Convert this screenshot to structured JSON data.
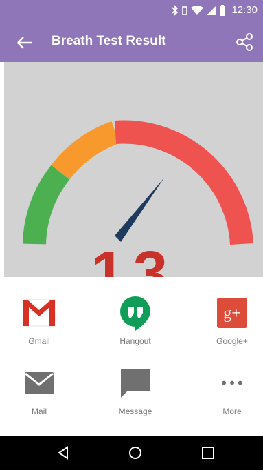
{
  "status_bar": {
    "time": "12:30"
  },
  "app_bar": {
    "title": "Breath Test Result"
  },
  "result": {
    "score_display": "13"
  },
  "share_options": [
    {
      "label": "Gmail"
    },
    {
      "label": "Hangout"
    },
    {
      "label": "Google+"
    },
    {
      "label": "Mail"
    },
    {
      "label": "Message"
    },
    {
      "label": "More"
    }
  ],
  "icons": {
    "google_plus_glyph": "g+",
    "more_glyph": "•••"
  },
  "colors": {
    "app_bar": "#8e76b8",
    "gauge_green": "#4caf50",
    "gauge_orange": "#f7992c",
    "gauge_red": "#ef5350",
    "needle": "#1f3a5f",
    "score": "#c8322a"
  }
}
